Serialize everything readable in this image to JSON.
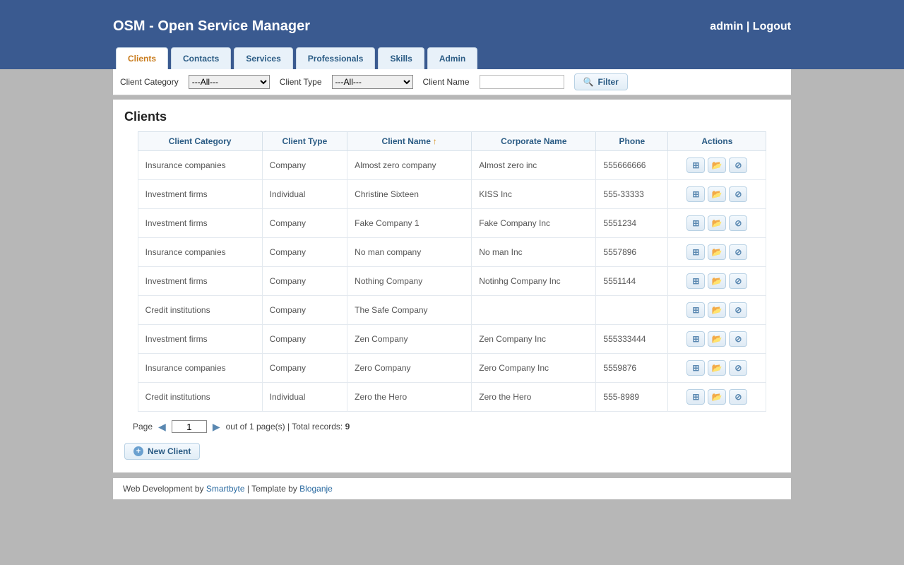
{
  "app": {
    "title": "OSM - Open Service Manager"
  },
  "user": {
    "name": "admin",
    "logout": "Logout",
    "separator": " | "
  },
  "tabs": [
    {
      "label": "Clients",
      "active": true
    },
    {
      "label": "Contacts",
      "active": false
    },
    {
      "label": "Services",
      "active": false
    },
    {
      "label": "Professionals",
      "active": false
    },
    {
      "label": "Skills",
      "active": false
    },
    {
      "label": "Admin",
      "active": false
    }
  ],
  "filter": {
    "category_label": "Client Category",
    "category_value": "---All---",
    "type_label": "Client Type",
    "type_value": "---All---",
    "name_label": "Client Name",
    "name_value": "",
    "button": "Filter"
  },
  "page": {
    "title": "Clients",
    "new_button": "New Client",
    "pager": {
      "page_label": "Page",
      "current": "1",
      "out_of": "out of 1 page(s) | Total records:",
      "total_records": "9"
    }
  },
  "table": {
    "headers": {
      "category": "Client Category",
      "type": "Client Type",
      "name": "Client Name",
      "corporate": "Corporate Name",
      "phone": "Phone",
      "actions": "Actions"
    },
    "sort_column": "name",
    "sort_dir": "asc",
    "rows": [
      {
        "category": "Insurance companies",
        "type": "Company",
        "name": "Almost zero company",
        "corporate": "Almost zero inc",
        "phone": "555666666"
      },
      {
        "category": "Investment firms",
        "type": "Individual",
        "name": "Christine Sixteen",
        "corporate": "KISS Inc",
        "phone": "555-33333"
      },
      {
        "category": "Investment firms",
        "type": "Company",
        "name": "Fake Company 1",
        "corporate": "Fake Company Inc",
        "phone": "5551234"
      },
      {
        "category": "Insurance companies",
        "type": "Company",
        "name": "No man company",
        "corporate": "No man Inc",
        "phone": "5557896"
      },
      {
        "category": "Investment firms",
        "type": "Company",
        "name": "Nothing Company",
        "corporate": "Notinhg Company Inc",
        "phone": "5551144"
      },
      {
        "category": "Credit institutions",
        "type": "Company",
        "name": "The Safe Company",
        "corporate": "",
        "phone": ""
      },
      {
        "category": "Investment firms",
        "type": "Company",
        "name": "Zen Company",
        "corporate": "Zen Company Inc",
        "phone": "555333444"
      },
      {
        "category": "Insurance companies",
        "type": "Company",
        "name": "Zero Company",
        "corporate": "Zero Company Inc",
        "phone": "5559876"
      },
      {
        "category": "Credit institutions",
        "type": "Individual",
        "name": "Zero the Hero",
        "corporate": "Zero the Hero",
        "phone": "555-8989"
      }
    ]
  },
  "footer": {
    "prefix": "Web Development by ",
    "link1": "Smartbyte",
    "mid": " | Template by ",
    "link2": "Bloganje"
  }
}
